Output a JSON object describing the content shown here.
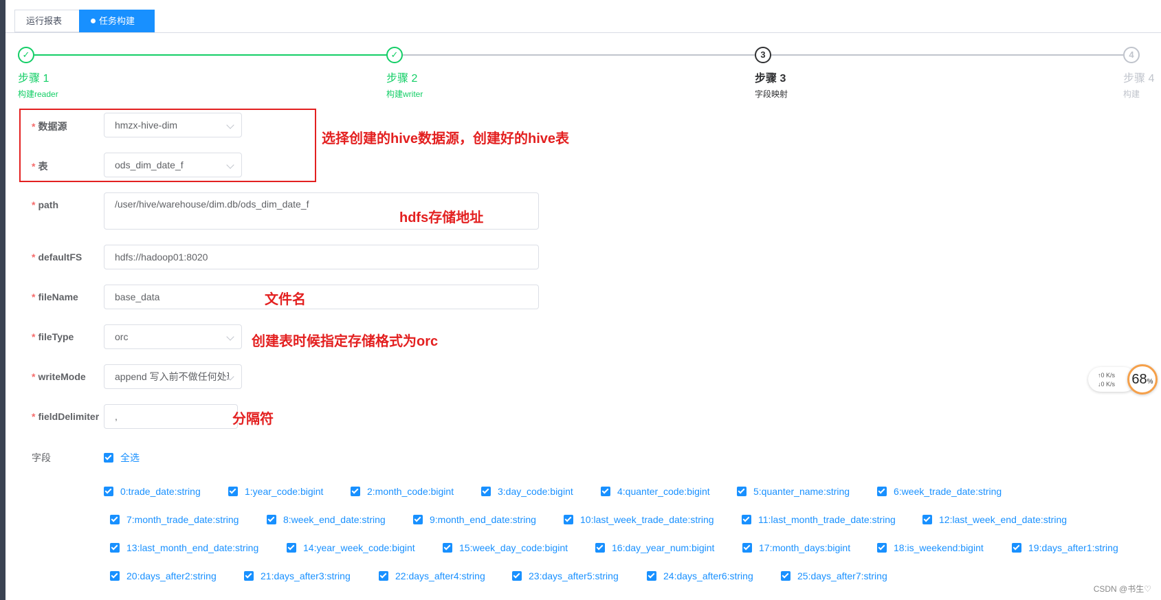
{
  "tabs": [
    {
      "label": "运行报表"
    },
    {
      "label": "任务构建",
      "close": "×"
    }
  ],
  "steps": [
    {
      "title": "步骤 1",
      "desc": "构建reader",
      "icon": "✓"
    },
    {
      "title": "步骤 2",
      "desc": "构建writer",
      "icon": "✓"
    },
    {
      "title": "步骤 3",
      "desc": "字段映射",
      "icon": "3"
    },
    {
      "title": "步骤 4",
      "desc": "构建",
      "icon": "4"
    }
  ],
  "form": {
    "datasource_label": "数据源",
    "datasource_value": "hmzx-hive-dim",
    "table_label": "表",
    "table_value": "ods_dim_date_f",
    "path_label": "path",
    "path_value": "/user/hive/warehouse/dim.db/ods_dim_date_f",
    "defaultfs_label": "defaultFS",
    "defaultfs_value": "hdfs://hadoop01:8020",
    "filename_label": "fileName",
    "filename_value": "base_data",
    "filetype_label": "fileType",
    "filetype_value": "orc",
    "writemode_label": "writeMode",
    "writemode_value": "append 写入前不做任何处理",
    "fielddelimiter_label": "fieldDelimiter",
    "fielddelimiter_value": ",",
    "fields_label": "字段",
    "select_all_label": "全选"
  },
  "annotations": {
    "datasource": "选择创建的hive数据源，创建好的hive表",
    "path": "hdfs存储地址",
    "filename": "文件名",
    "filetype": "创建表时候指定存储格式为orc",
    "delimiter": "分隔符"
  },
  "fields": [
    "0:trade_date:string",
    "1:year_code:bigint",
    "2:month_code:bigint",
    "3:day_code:bigint",
    "4:quanter_code:bigint",
    "5:quanter_name:string",
    "6:week_trade_date:string",
    "7:month_trade_date:string",
    "8:week_end_date:string",
    "9:month_end_date:string",
    "10:last_week_trade_date:string",
    "11:last_month_trade_date:string",
    "12:last_week_end_date:string",
    "13:last_month_end_date:string",
    "14:year_week_code:bigint",
    "15:week_day_code:bigint",
    "16:day_year_num:bigint",
    "17:month_days:bigint",
    "18:is_weekend:bigint",
    "19:days_after1:string",
    "20:days_after2:string",
    "21:days_after3:string",
    "22:days_after4:string",
    "23:days_after5:string",
    "24:days_after6:string",
    "25:days_after7:string"
  ],
  "speed": {
    "up": "↑0 K/s",
    "down": "↓0 K/s",
    "percent": "68",
    "unit": "%"
  },
  "watermark": "CSDN @书生♡",
  "colors": {
    "accent": "#1890ff",
    "done": "#13ce66",
    "annotation": "#e32020"
  }
}
